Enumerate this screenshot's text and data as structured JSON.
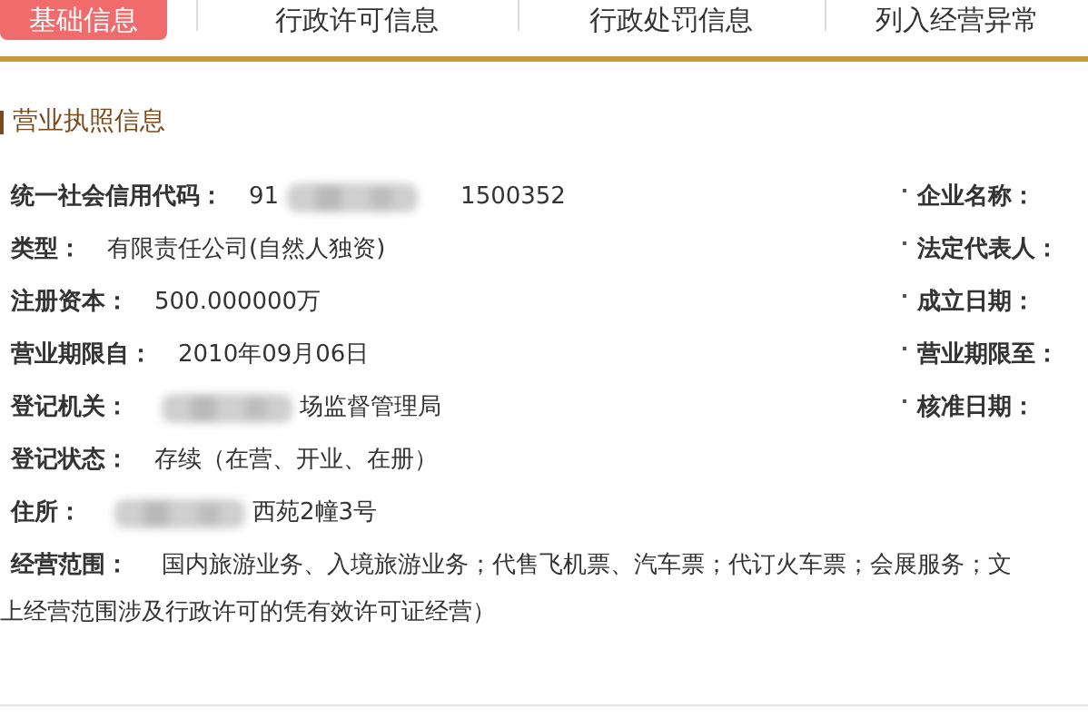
{
  "tabs": [
    {
      "label": "基础信息",
      "selected": true
    },
    {
      "label": "行政许可信息",
      "selected": false
    },
    {
      "label": "行政处罚信息",
      "selected": false
    },
    {
      "label": "列入经营异常",
      "selected": false
    }
  ],
  "section": {
    "title": "营业执照信息"
  },
  "rows": [
    {
      "left": {
        "label": "统一社会信用代码：",
        "segments": [
          {
            "kind": "text",
            "text": "91"
          },
          {
            "kind": "blur"
          },
          {
            "kind": "text",
            "text": "1500352"
          }
        ]
      },
      "right": {
        "label": "企业名称："
      }
    },
    {
      "left": {
        "label": "类型：",
        "segments": [
          {
            "kind": "text",
            "text": "有限责任公司(自然人独资)"
          }
        ]
      },
      "right": {
        "label": "法定代表人："
      }
    },
    {
      "left": {
        "label": "注册资本：",
        "segments": [
          {
            "kind": "text",
            "text": "500.000000万"
          }
        ]
      },
      "right": {
        "label": "成立日期："
      }
    },
    {
      "left": {
        "label": "营业期限自：",
        "segments": [
          {
            "kind": "text",
            "text": "2010年09月06日"
          }
        ]
      },
      "right": {
        "label": "营业期限至："
      }
    },
    {
      "left": {
        "label": "登记机关：",
        "segments": [
          {
            "kind": "blur"
          },
          {
            "kind": "text",
            "text": "场监督管理局"
          }
        ]
      },
      "right": {
        "label": "核准日期："
      }
    },
    {
      "left": {
        "label": "登记状态：",
        "segments": [
          {
            "kind": "text",
            "text": "存续（在营、开业、在册）"
          }
        ]
      }
    },
    {
      "left": {
        "label": "住所：",
        "segments": [
          {
            "kind": "blur"
          },
          {
            "kind": "text",
            "text": "西苑2幢3号"
          }
        ]
      }
    }
  ],
  "scope": {
    "label": "经营范围：",
    "line_1": "国内旅游业务、入境旅游业务；代售飞机票、汽车票；代订火车票；会展服务；文",
    "line_2": "上经营范围涉及行政许可的凭有效许可证经营）"
  }
}
